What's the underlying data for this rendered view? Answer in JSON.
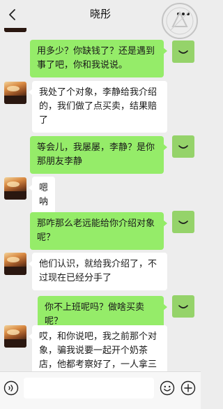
{
  "header": {
    "title": "晓彤",
    "back_icon": "chevron-left-icon",
    "more_icon": "more-dots-icon"
  },
  "messages": [
    {
      "from": "other",
      "text": ""
    },
    {
      "from": "self",
      "text": "用多少？你缺钱了？还是遇到事了吧，你和我说说。"
    },
    {
      "from": "other",
      "text": "我处了个对象，李静给我介绍的，我们做了点买卖，结果赔了"
    },
    {
      "from": "self",
      "text": "等会儿，我屡屡，李静？是你那朋友李静"
    },
    {
      "from": "other",
      "text": "嗯呐"
    },
    {
      "from": "self",
      "text": "那咋那么老远能给你介绍对象呢？"
    },
    {
      "from": "other",
      "text": "他们认识，就给我介绍了，不过现在已经分手了"
    },
    {
      "from": "self",
      "text": "你不上班呢吗？做啥买卖呢？"
    },
    {
      "from": "other",
      "text": "哎，和你说吧，我之前那个对象，骗我说要一起开个奶茶店，他都考察好了，一人拿三万块钱就够了，我就信他了"
    }
  ],
  "input": {
    "value": "",
    "voice_icon": "voice-icon",
    "emoji_icon": "emoji-icon",
    "plus_icon": "plus-icon"
  },
  "colors": {
    "background": "#ededed",
    "self_bubble": "#95ec69",
    "other_bubble": "#ffffff",
    "self_avatar": "#95d36a"
  }
}
